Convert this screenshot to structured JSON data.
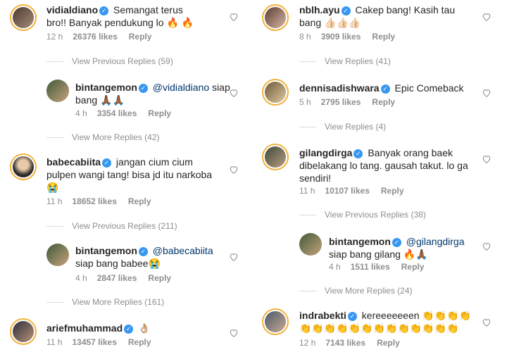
{
  "left": {
    "c1": {
      "user": "vidialdiano",
      "text": "Semangat terus bro!! Banyak pendukung lo 🔥 🔥",
      "time": "12 h",
      "likes": "26376 likes",
      "reply": "Reply"
    },
    "v1": "View Previous Replies (59)",
    "r1": {
      "user": "bintangemon",
      "mention": "@vidialdiano",
      "text": "siap bang 🙏🏾🙏🏾",
      "time": "4 h",
      "likes": "3354 likes",
      "reply": "Reply"
    },
    "v2": "View More Replies (42)",
    "c2": {
      "user": "babecabiita",
      "text": "jangan cium cium pulpen wangi tang! bisa jd itu narkoba 😭",
      "time": "11 h",
      "likes": "18652 likes",
      "reply": "Reply"
    },
    "v3": "View Previous Replies (211)",
    "r2": {
      "user": "bintangemon",
      "mention": "@babecabiita",
      "text": "siap bang babee😭",
      "time": "4 h",
      "likes": "2847 likes",
      "reply": "Reply"
    },
    "v4": "View More Replies (161)",
    "c3": {
      "user": "ariefmuhammad",
      "text": "👌🏼",
      "time": "11 h",
      "likes": "13457 likes",
      "reply": "Reply"
    }
  },
  "right": {
    "c1": {
      "user": "nblh.ayu",
      "text": "Cakep bang! Kasih tau bang 👍🏻👍🏻👍🏻",
      "time": "8 h",
      "likes": "3909 likes",
      "reply": "Reply"
    },
    "v1": "View Replies (41)",
    "c2": {
      "user": "dennisadishwara",
      "text": "Epic Comeback",
      "time": "5 h",
      "likes": "2795 likes",
      "reply": "Reply"
    },
    "v2": "View Replies (4)",
    "c3": {
      "user": "gilangdirga",
      "text": "Banyak orang baek dibelakang lo tang. gausah takut. lo ga sendiri!",
      "time": "11 h",
      "likes": "10107 likes",
      "reply": "Reply"
    },
    "v3": "View Previous Replies (38)",
    "r1": {
      "user": "bintangemon",
      "mention": "@gilangdirga",
      "text": "siap bang gilang 🔥🙏🏾",
      "time": "4 h",
      "likes": "1511 likes",
      "reply": "Reply"
    },
    "v4": "View More Replies (24)",
    "c4": {
      "user": "indrabekti",
      "text": "kereeeeeeen 👏👏👏👏👏👏👏👏👏👏👏👏👏👏👏👏👏",
      "time": "12 h",
      "likes": "7143 likes",
      "reply": "Reply"
    }
  },
  "colors": {
    "ring": "#f0b23a",
    "verified": "#3897f0",
    "mention": "#00376b",
    "meta": "#8e8e8e"
  },
  "icons": {
    "like": "heart-outline-icon",
    "verified": "verified-badge-icon"
  }
}
